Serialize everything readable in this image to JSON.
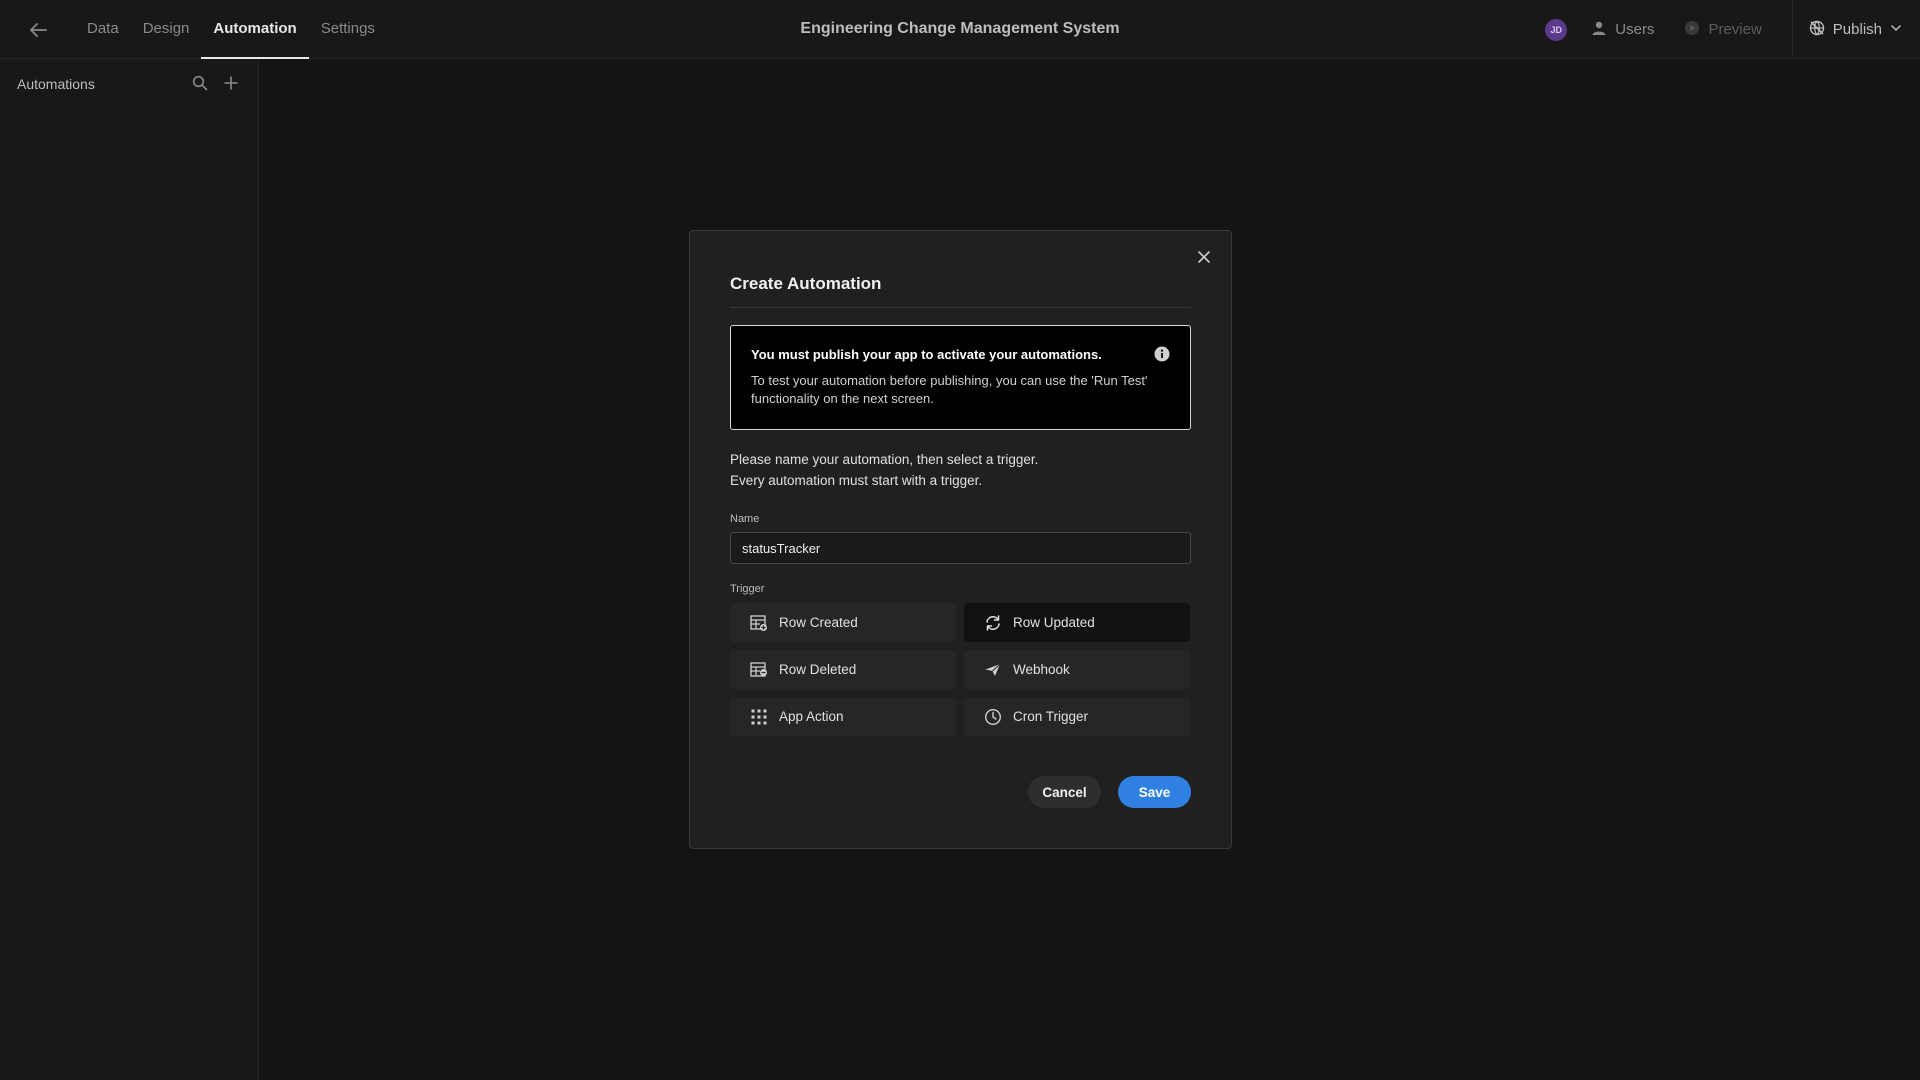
{
  "topbar": {
    "back_icon": "arrow-left-icon",
    "tabs": [
      {
        "label": "Data",
        "active": false
      },
      {
        "label": "Design",
        "active": false
      },
      {
        "label": "Automation",
        "active": true
      },
      {
        "label": "Settings",
        "active": false
      }
    ],
    "app_title": "Engineering Change Management System",
    "avatar_initials": "JD",
    "users_label": "Users",
    "preview_label": "Preview",
    "publish_label": "Publish"
  },
  "sidebar": {
    "title": "Automations",
    "search_icon": "search-icon",
    "add_icon": "plus-icon"
  },
  "modal": {
    "title": "Create Automation",
    "notice": {
      "title": "You must publish your app to activate your automations.",
      "body": "To test your automation before publishing, you can use the 'Run Test' functionality on the next screen."
    },
    "intro_line1": "Please name your automation, then select a trigger.",
    "intro_line2": "Every automation must start with a trigger.",
    "name_label": "Name",
    "name_value": "statusTracker",
    "trigger_label": "Trigger",
    "triggers": [
      {
        "label": "Row Created",
        "icon": "table-plus-icon",
        "selected": false
      },
      {
        "label": "Row Updated",
        "icon": "refresh-icon",
        "selected": true
      },
      {
        "label": "Row Deleted",
        "icon": "table-minus-icon",
        "selected": false
      },
      {
        "label": "Webhook",
        "icon": "send-icon",
        "selected": false
      },
      {
        "label": "App Action",
        "icon": "grid-dots-icon",
        "selected": false
      },
      {
        "label": "Cron Trigger",
        "icon": "clock-icon",
        "selected": false
      }
    ],
    "cancel_label": "Cancel",
    "save_label": "Save"
  },
  "colors": {
    "accent": "#2f80e0",
    "background": "#141414",
    "modal": "#202020",
    "avatar": "#5b3a8c"
  }
}
